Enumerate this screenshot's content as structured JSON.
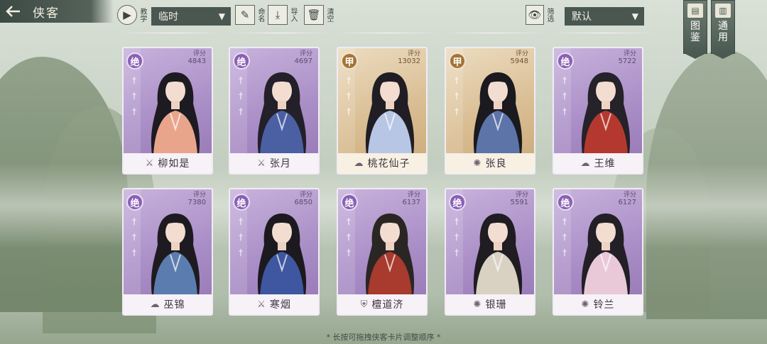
{
  "header": {
    "back_icon": "arrow-left-icon",
    "title": "侠客"
  },
  "toolbar": {
    "tutorial_label": "教学",
    "team_select": "临时",
    "rename_label": "命名",
    "import_label": "导入",
    "clear_label": "清空",
    "filter_label": "筛选",
    "sort_select": "默认"
  },
  "side_buttons": {
    "codex_label": "图鉴",
    "general_label": "通用"
  },
  "score_label": "评分",
  "colors": {
    "jue_card": "#a98dc6",
    "jia_card": "#d9bd92",
    "topbar": "#4a5751"
  },
  "cards": [
    {
      "rank": "绝",
      "score": "4843",
      "name": "柳如是",
      "emblem": "sword-emblem-icon"
    },
    {
      "rank": "绝",
      "score": "4697",
      "name": "张月",
      "emblem": "sword-emblem-icon"
    },
    {
      "rank": "甲",
      "score": "13032",
      "name": "桃花仙子",
      "emblem": "cloud-emblem-icon"
    },
    {
      "rank": "甲",
      "score": "5948",
      "name": "张良",
      "emblem": "swirl-emblem-icon"
    },
    {
      "rank": "绝",
      "score": "5722",
      "name": "王维",
      "emblem": "cloud-emblem-icon"
    },
    {
      "rank": "绝",
      "score": "7380",
      "name": "巫锦",
      "emblem": "cloud-emblem-icon"
    },
    {
      "rank": "绝",
      "score": "6850",
      "name": "寒烟",
      "emblem": "sword-emblem-icon"
    },
    {
      "rank": "绝",
      "score": "6137",
      "name": "檀道济",
      "emblem": "shield-emblem-icon"
    },
    {
      "rank": "绝",
      "score": "5591",
      "name": "银珊",
      "emblem": "swirl-emblem-icon"
    },
    {
      "rank": "绝",
      "score": "6127",
      "name": "铃兰",
      "emblem": "swirl-emblem-icon"
    }
  ],
  "footer_hint": "* 长按可拖拽侠客卡片调整顺序 *"
}
